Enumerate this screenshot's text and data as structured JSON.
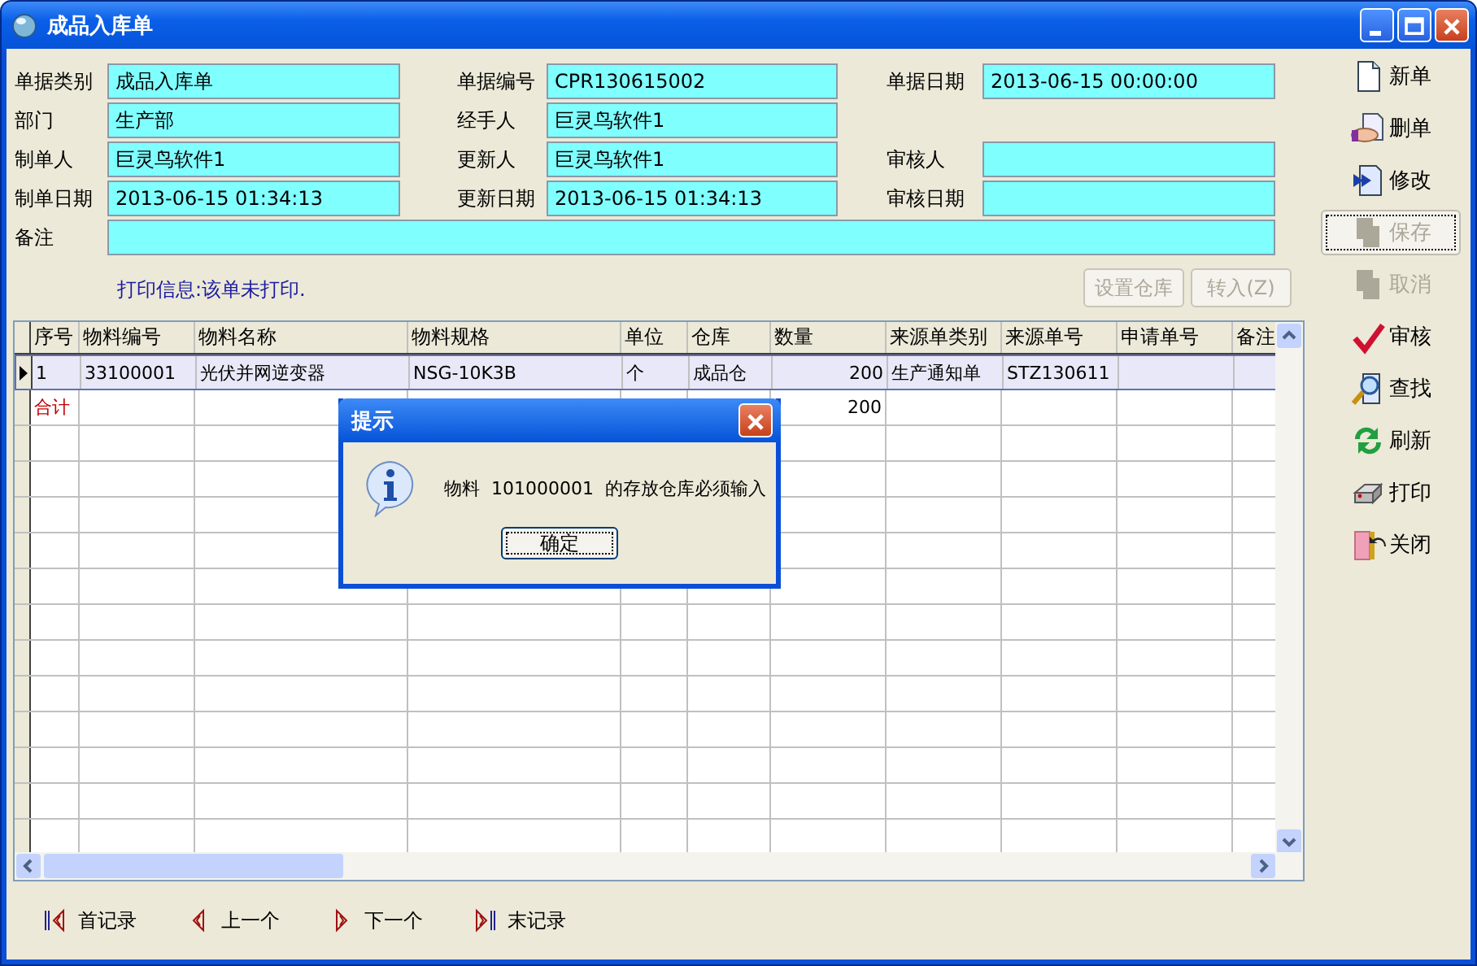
{
  "window": {
    "title": "成品入库单"
  },
  "form": {
    "rows": [
      [
        {
          "label": "单据类别",
          "value": "成品入库单"
        },
        {
          "label": "单据编号",
          "value": "CPR130615002"
        },
        {
          "label": "单据日期",
          "value": "2013-06-15 00:00:00"
        }
      ],
      [
        {
          "label": "部门",
          "value": "生产部"
        },
        {
          "label": "经手人",
          "value": "巨灵鸟软件1"
        }
      ],
      [
        {
          "label": "制单人",
          "value": "巨灵鸟软件1"
        },
        {
          "label": "更新人",
          "value": "巨灵鸟软件1"
        },
        {
          "label": "审核人"
        }
      ],
      [
        {
          "label": "制单日期",
          "value": "2013-06-15 01:34:13"
        },
        {
          "label": "更新日期",
          "value": "2013-06-15 01:34:13"
        },
        {
          "label": "审核日期"
        }
      ],
      [
        {
          "label": "备注",
          "kind": "wide"
        }
      ]
    ]
  },
  "print_info": "打印信息:该单未打印.",
  "form_buttons": [
    {
      "label": "设置仓库",
      "disabled": true
    },
    {
      "label": "转入(Z)",
      "disabled": true
    }
  ],
  "table": {
    "columns": [
      {
        "label": "序号"
      },
      {
        "label": "物料编号"
      },
      {
        "label": "物料名称"
      },
      {
        "label": "物料规格"
      },
      {
        "label": "单位"
      },
      {
        "label": "仓库"
      },
      {
        "label": "数量",
        "kind": "number"
      },
      {
        "label": "来源单类别"
      },
      {
        "label": "来源单号"
      },
      {
        "label": "申请单号"
      },
      {
        "label": "备注"
      }
    ],
    "rows": [
      {
        "kind": "item",
        "selected": true,
        "cells": [
          "1",
          "33100001",
          "光伏并网逆变器",
          "NSG-10K3B",
          "个",
          "成品仓",
          "200",
          "生产通知单",
          "STZ130611"
        ]
      },
      {
        "kind": "total",
        "selected": false,
        "cells": [
          "合计",
          "",
          "",
          "",
          "",
          "",
          "200"
        ]
      }
    ]
  },
  "toolbar": [
    {
      "label": "新单",
      "disabled": false,
      "focused": false
    },
    {
      "label": "删单",
      "disabled": false,
      "focused": false
    },
    {
      "label": "修改",
      "disabled": false,
      "focused": false
    },
    {
      "label": "保存",
      "disabled": true,
      "focused": true
    },
    {
      "label": "取消",
      "disabled": true,
      "focused": false
    },
    {
      "label": "审核",
      "disabled": false,
      "focused": false
    },
    {
      "label": "查找",
      "disabled": false,
      "focused": false
    },
    {
      "label": "刷新",
      "disabled": false,
      "focused": false
    },
    {
      "label": "打印",
      "disabled": false,
      "focused": false
    },
    {
      "label": "关闭",
      "disabled": false,
      "focused": false
    }
  ],
  "nav": [
    {
      "label": "首记录"
    },
    {
      "label": "上一个"
    },
    {
      "label": "下一个"
    },
    {
      "label": "末记录"
    }
  ],
  "dialog": {
    "title": "提示",
    "message": "物料  101000001  的存放仓库必须输入",
    "button": "确定"
  }
}
